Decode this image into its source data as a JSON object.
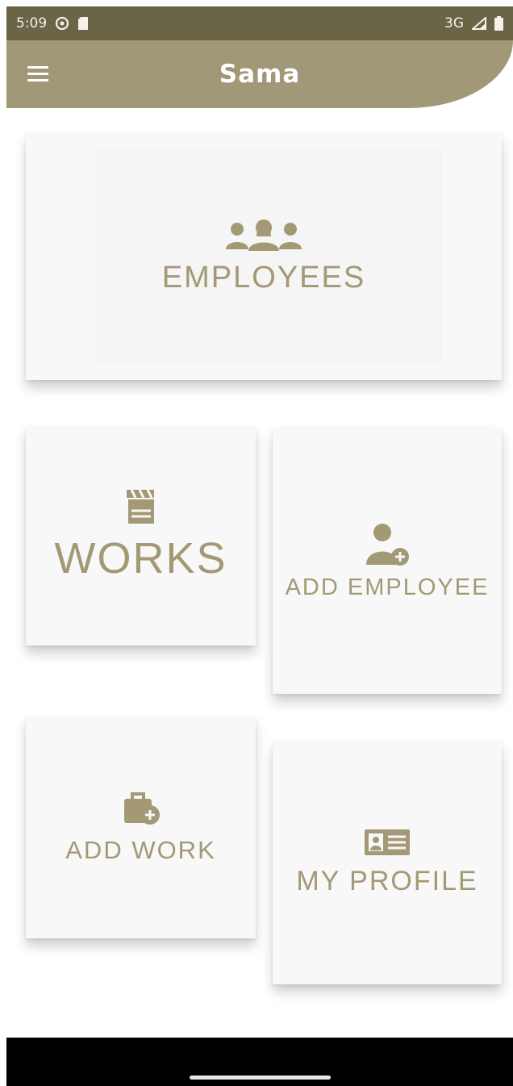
{
  "status_bar": {
    "time": "5:09",
    "network": "3G"
  },
  "app_bar": {
    "title": "Sama",
    "menu_icon": "menu-icon"
  },
  "cards": {
    "employees": {
      "label": "EMPLOYEES",
      "icon": "people-group-icon"
    },
    "works": {
      "label": "WORKS",
      "icon": "clapperboard-icon"
    },
    "add_employee": {
      "label": "ADD EMPLOYEE",
      "icon": "add-user-icon"
    },
    "add_work": {
      "label": "ADD WORK",
      "icon": "add-briefcase-icon"
    },
    "my_profile": {
      "label": "MY PROFILE",
      "icon": "id-card-icon"
    }
  },
  "colors": {
    "status_bar": "#6b6547",
    "app_bar": "#a09877",
    "accent": "#a39975",
    "card_bg": "#f8f8f8"
  }
}
